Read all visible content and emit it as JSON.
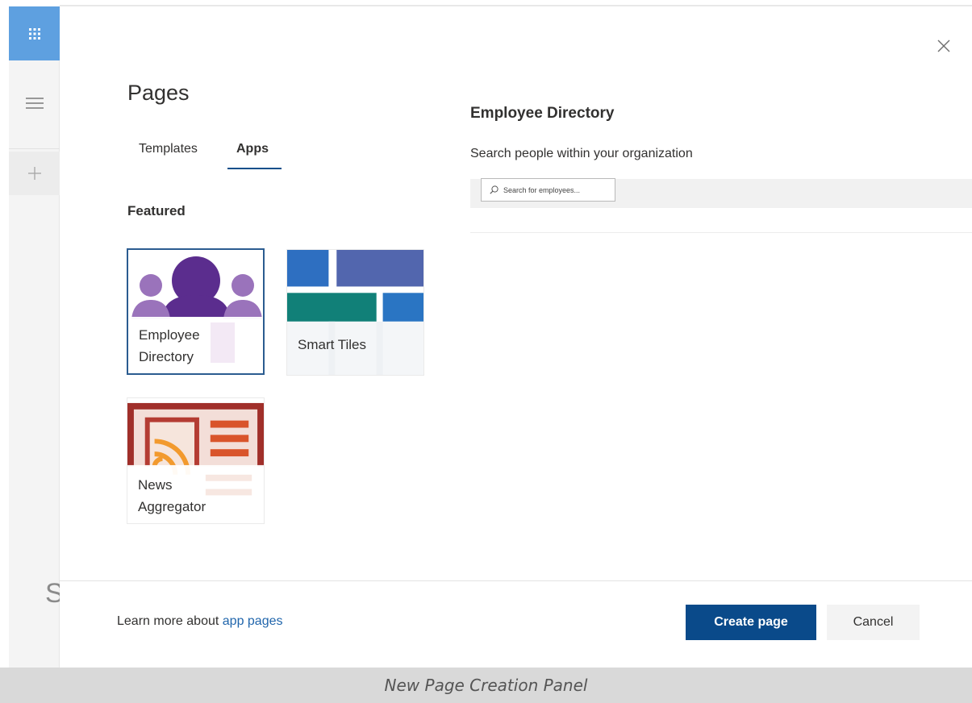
{
  "panel": {
    "title": "Pages",
    "tabs": [
      {
        "label": "Templates",
        "selected": false
      },
      {
        "label": "Apps",
        "selected": true
      }
    ],
    "featured_heading": "Featured",
    "tiles": [
      {
        "label": "Employee\nDirectory",
        "icon": "people-icon",
        "selected": true
      },
      {
        "label": "Smart Tiles",
        "icon": "tiles-icon",
        "selected": false
      },
      {
        "label": "News\nAggregator",
        "icon": "rss-icon",
        "selected": false
      }
    ]
  },
  "preview": {
    "title": "Employee Directory",
    "description": "Search people within your organization",
    "search_placeholder": "Search for employees..."
  },
  "footer": {
    "learn_more_prefix": "Learn more about",
    "learn_more_link": "app pages",
    "create_label": "Create page",
    "cancel_label": "Cancel"
  },
  "caption": "New Page Creation Panel",
  "colors": {
    "primary": "#0a4a8a",
    "link": "#2166ac",
    "waffle_bg": "#5ea0e0",
    "people_purple": "#5b2d8e"
  },
  "icons": {
    "waffle": "waffle-icon",
    "menu": "hamburger-icon",
    "add": "plus-icon",
    "close": "close-icon",
    "search": "search-icon"
  }
}
